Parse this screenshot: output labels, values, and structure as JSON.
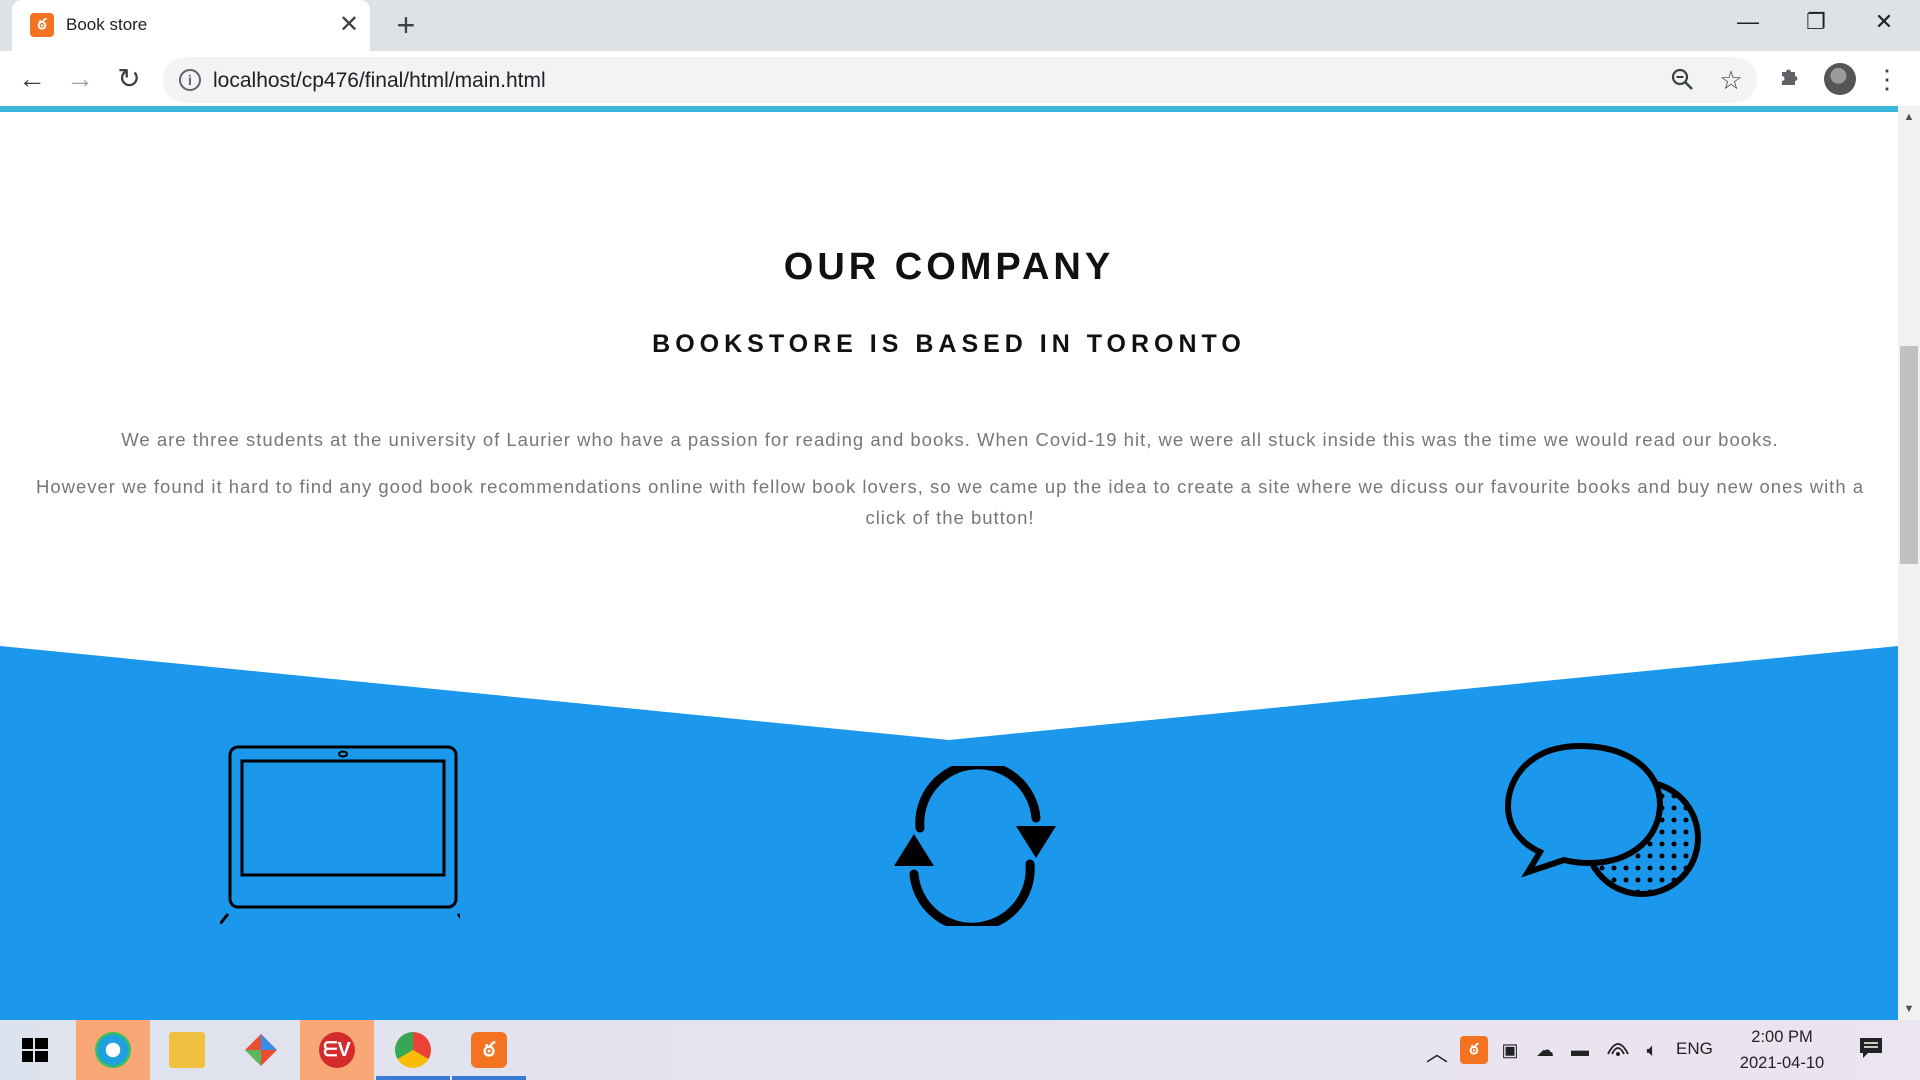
{
  "browser": {
    "tab_title": "Book store",
    "tab_close_glyph": "✕",
    "new_tab_glyph": "+",
    "url": "localhost/cp476/final/html/main.html",
    "window_controls": {
      "minimize": "—",
      "maximize": "❐",
      "close": "✕"
    },
    "nav": {
      "back": "←",
      "forward": "→",
      "reload": "↻"
    },
    "icons": [
      "info-icon",
      "zoom-out-icon",
      "bookmark-star-icon",
      "extensions-icon",
      "profile-avatar",
      "menu-icon"
    ]
  },
  "page": {
    "title": "OUR COMPANY",
    "subtitle": "BOOKSTORE IS BASED IN TORONTO",
    "paragraph_1": "We are three students at the university of Laurier who have a passion for reading and books. When Covid-19 hit, we were all stuck inside this was the time we would read our books.",
    "paragraph_2": "However we found it hard to find any good book recommendations online with fellow book lovers, so we came up the idea to create a site where we dicuss our favourite books and buy new ones with a click of the button!",
    "feature_icons": [
      "laptop-icon",
      "sync-icon",
      "chat-bubbles-icon"
    ],
    "colors": {
      "accent_bar": "#3bb6d9",
      "section_blue": "#1b98ec",
      "text_gray": "#777777"
    }
  },
  "taskbar": {
    "apps": [
      {
        "name": "edge",
        "active": true
      },
      {
        "name": "file-explorer",
        "active": false
      },
      {
        "name": "git",
        "active": false
      },
      {
        "name": "expressvpn",
        "label": "ᗴV",
        "active": true
      },
      {
        "name": "chrome",
        "active": false,
        "open": true
      },
      {
        "name": "xampp",
        "active": false,
        "open": true
      }
    ],
    "language": "ENG",
    "time": "2:00 PM",
    "date": "2021-04-10"
  }
}
